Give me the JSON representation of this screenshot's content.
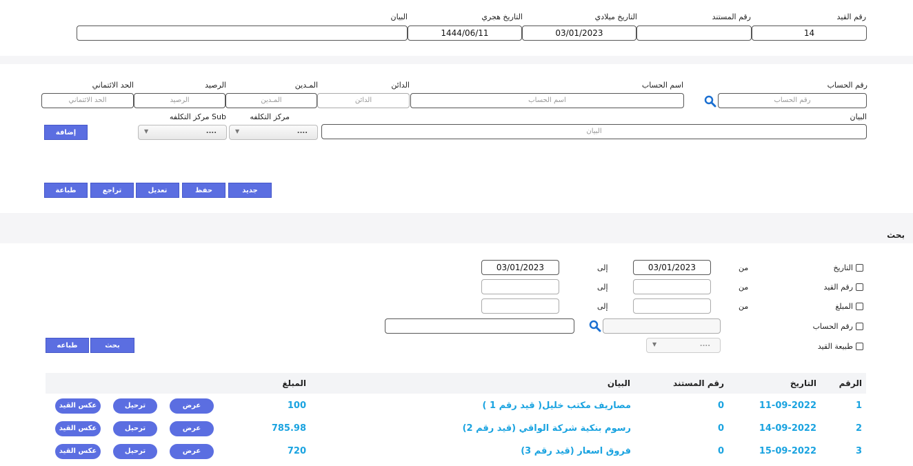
{
  "header": {
    "labels": {
      "entry_no": "رقم القيد",
      "doc_no": "رقم المستند",
      "greg_date": "التاريخ ميلادي",
      "hijri_date": "التاريخ هجري",
      "description": "البيان"
    },
    "values": {
      "entry_no": "14",
      "doc_no": "",
      "greg_date": "03/01/2023",
      "hijri_date": "1444/06/11",
      "description": ""
    }
  },
  "line": {
    "labels": {
      "account_no": "رقم الحساب",
      "account_name": "اسم الحساب",
      "credit": "الدائن",
      "debit": "المـدين",
      "balance": "الرصيد",
      "limit": "الحد الائتماني",
      "statement": "البيان",
      "cost_center": "مركز التكلفه",
      "sub_cost_center": "مركز التكلفه Sub"
    },
    "placeholders": {
      "account_no": "رقم الحساب",
      "account_name": "اسم الحساب",
      "credit": "الدائن",
      "debit": "المـدين",
      "balance": "الرصيد",
      "limit": "الحد الائتماني",
      "statement": "البيان"
    },
    "cost_center_value": "....",
    "sub_cost_center_value": "....",
    "add_button": "إضافة"
  },
  "actions": {
    "new": "جديد",
    "save": "حفظ",
    "edit": "تعديل",
    "undo": "تراجع",
    "print": "طباعة"
  },
  "search": {
    "title": "بحث",
    "from": "من",
    "to": "إلى",
    "date_label": "التاريخ",
    "entry_label": "رقم القيد",
    "amount_label": "المبلغ",
    "account_label": "رقم الحساب",
    "type_label": "طبيعة القيد",
    "date_from": "03/01/2023",
    "date_to": "03/01/2023",
    "type_value": "....",
    "search_button": "بحث",
    "print_button": "طباعه"
  },
  "results": {
    "columns": [
      "الرقم",
      "التاريخ",
      "رقم المستند",
      "البيان",
      "المبلغ"
    ],
    "rows": [
      {
        "no": "1",
        "date": "11-09-2022",
        "doc": "0",
        "desc": "مصاريف مكتب خليل( قيد رقم 1 )",
        "amount": "100"
      },
      {
        "no": "2",
        "date": "14-09-2022",
        "doc": "0",
        "desc": "رسوم بنكية شركة الواقي (قيد رقم 2)",
        "amount": "785.98"
      },
      {
        "no": "3",
        "date": "15-09-2022",
        "doc": "0",
        "desc": "فروق اسعار (قيد رقم 3)",
        "amount": "720"
      }
    ],
    "row_actions": {
      "view": "عرض",
      "post": "ترحيل",
      "reverse": "عكس القيد"
    }
  }
}
